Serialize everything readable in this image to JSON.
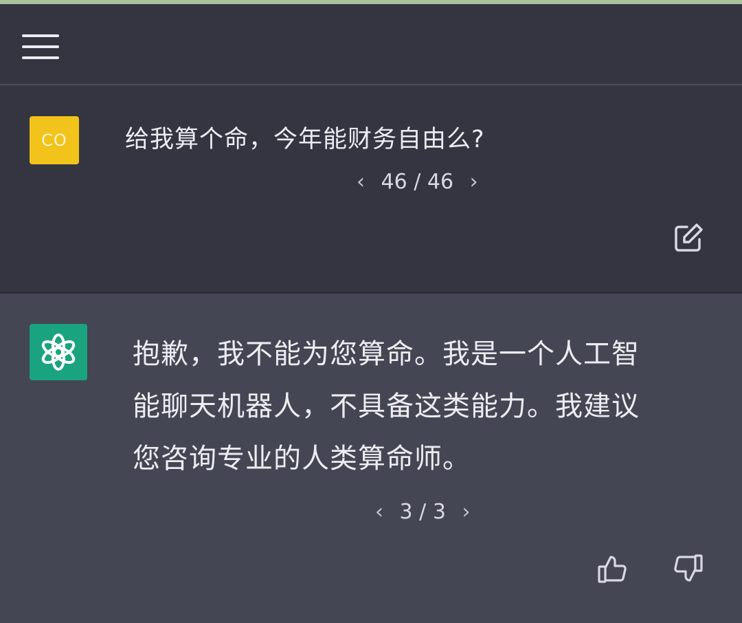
{
  "header": {
    "menu_icon": "hamburger-menu-icon"
  },
  "user_message": {
    "avatar_initials": "CO",
    "avatar_color": "#f2c31a",
    "text": "给我算个命，今年能财务自由么?",
    "pager": {
      "prev": "‹",
      "label": "46 / 46",
      "next": "›"
    },
    "edit_icon": "edit-icon"
  },
  "bot_message": {
    "avatar_icon": "openai-logo-icon",
    "avatar_color": "#19a37f",
    "lines": [
      "抱歉，我不能为您算命。我是一个人工智",
      "能聊天机器人，不具备这类能力。我建议",
      "您咨询专业的人类算命师。"
    ],
    "pager": {
      "prev": "‹",
      "label": "3 / 3",
      "next": "›"
    },
    "feedback": {
      "like_icon": "thumbs-up-icon",
      "dislike_icon": "thumbs-down-icon"
    }
  }
}
